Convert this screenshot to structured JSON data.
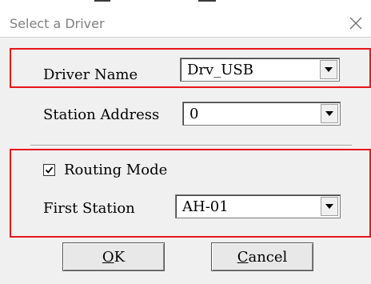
{
  "dialog": {
    "title": "Select a Driver",
    "close_icon": "close-icon"
  },
  "driver_name": {
    "label": "Driver Name",
    "value": "Drv_USB"
  },
  "station_address": {
    "label": "Station Address",
    "value": "0"
  },
  "routing_mode": {
    "label": "Routing Mode",
    "checked": true
  },
  "first_station": {
    "label": "First Station",
    "value": "AH-01"
  },
  "buttons": {
    "ok_mnemonic": "O",
    "ok_rest": "K",
    "cancel_mnemonic": "C",
    "cancel_rest": "ancel"
  },
  "colors": {
    "highlight_border": "#e8161a",
    "dialog_background": "#f0f0f0"
  }
}
